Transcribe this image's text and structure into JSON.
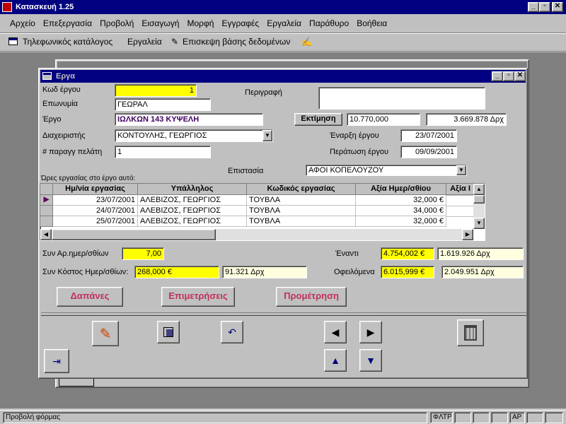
{
  "app": {
    "title": "Κατασκευή 1.25"
  },
  "menu": [
    "Αρχείο",
    "Επεξεργασία",
    "Προβολή",
    "Εισαγωγή",
    "Μορφή",
    "Εγγραφές",
    "Εργαλεία",
    "Παράθυρο",
    "Βοήθεια"
  ],
  "toolbar": {
    "phonebook": "Τηλεφωνικός κατάλογος",
    "tools": "Εργαλεία",
    "db_visit": "Επισκεψη βάσης δεδομένων"
  },
  "form": {
    "title": "Εργα",
    "labels": {
      "kod_ergou": "Κωδ έργου",
      "eponymia": "Επωνυμία",
      "ergo": "Έργο",
      "diaxeiristis": "Διαχειριστής",
      "paragg": "# παραγγ πελάτη",
      "perigrafi": "Περιγραφή",
      "ektimisi": "Εκτίμηση",
      "enarxi": "Έναρξη έργου",
      "peratosi": "Περάτωση έργου",
      "epistasia": "Επιστασία",
      "ores": "Ώρες εργασίας στο έργο αυτό:"
    },
    "values": {
      "kod_ergou": "1",
      "eponymia": "ΓΕΩΡΑΛ",
      "ergo": "ΙΩΛΚΩΝ 143 ΚΥΨΕΛΗ",
      "diaxeiristis": "ΚΟΝΤΟΥΛΗΣ, ΓΕΩΡΓΙΟΣ",
      "paragg": "1",
      "perigrafi": "",
      "ektimisi_eur": "10.770,000",
      "ektimisi_drx": "3.669.878 Δρχ",
      "enarxi": "23/07/2001",
      "peratosi": "09/09/2001",
      "epistasia": "ΑΦΟΙ ΚΟΠΕΛΟΥΖΟΥ"
    },
    "grid": {
      "columns": [
        "Ημ/νία εργασίας",
        "Υπάλληλος",
        "Κωδικός εργασίας",
        "Αξία Ημερ/σθίου",
        "Αξία Ι"
      ],
      "rows": [
        [
          "23/07/2001",
          "ΑΛΕΒΙΖΟΣ, ΓΕΩΡΓΙΟΣ",
          "ΤΟΥΒΛΑ",
          "32,000 €",
          ""
        ],
        [
          "24/07/2001",
          "ΑΛΕΒΙΖΟΣ, ΓΕΩΡΓΙΟΣ",
          "ΤΟΥΒΛΑ",
          "34,000 €",
          ""
        ],
        [
          "25/07/2001",
          "ΑΛΕΒΙΖΟΣ, ΓΕΩΡΓΙΟΣ",
          "ΤΟΥΒΛΑ",
          "32,000 €",
          ""
        ]
      ]
    },
    "summary": {
      "lbl_days": "Συν Αρ.ημερ/σθίων",
      "days": "7,00",
      "lbl_cost": "Συν Κόστος Ημερ/σθίων:",
      "cost_eur": "268,000 €",
      "cost_drx": "91.321 Δρχ",
      "lbl_enanti": "Έναντι",
      "enanti_eur": "4.754,002 €",
      "enanti_drx": "1.619.926 Δρχ",
      "lbl_ofeil": "Οφειλόμενα",
      "ofeil_eur": "6.015,999 €",
      "ofeil_drx": "2.049.951 Δρχ"
    },
    "buttons": {
      "dapanes": "Δαπάνες",
      "epimetriseis": "Επιμετρήσεις",
      "prometrisi": "Προμέτρηση"
    }
  },
  "status": {
    "text": "Προβολή φόρμας",
    "filter": "ΦΛΤΡ",
    "ar": "ΑΡ"
  },
  "colors": {
    "title_active": "#000080",
    "field_yellow": "#ffff00",
    "button_text": "#c0305a"
  }
}
